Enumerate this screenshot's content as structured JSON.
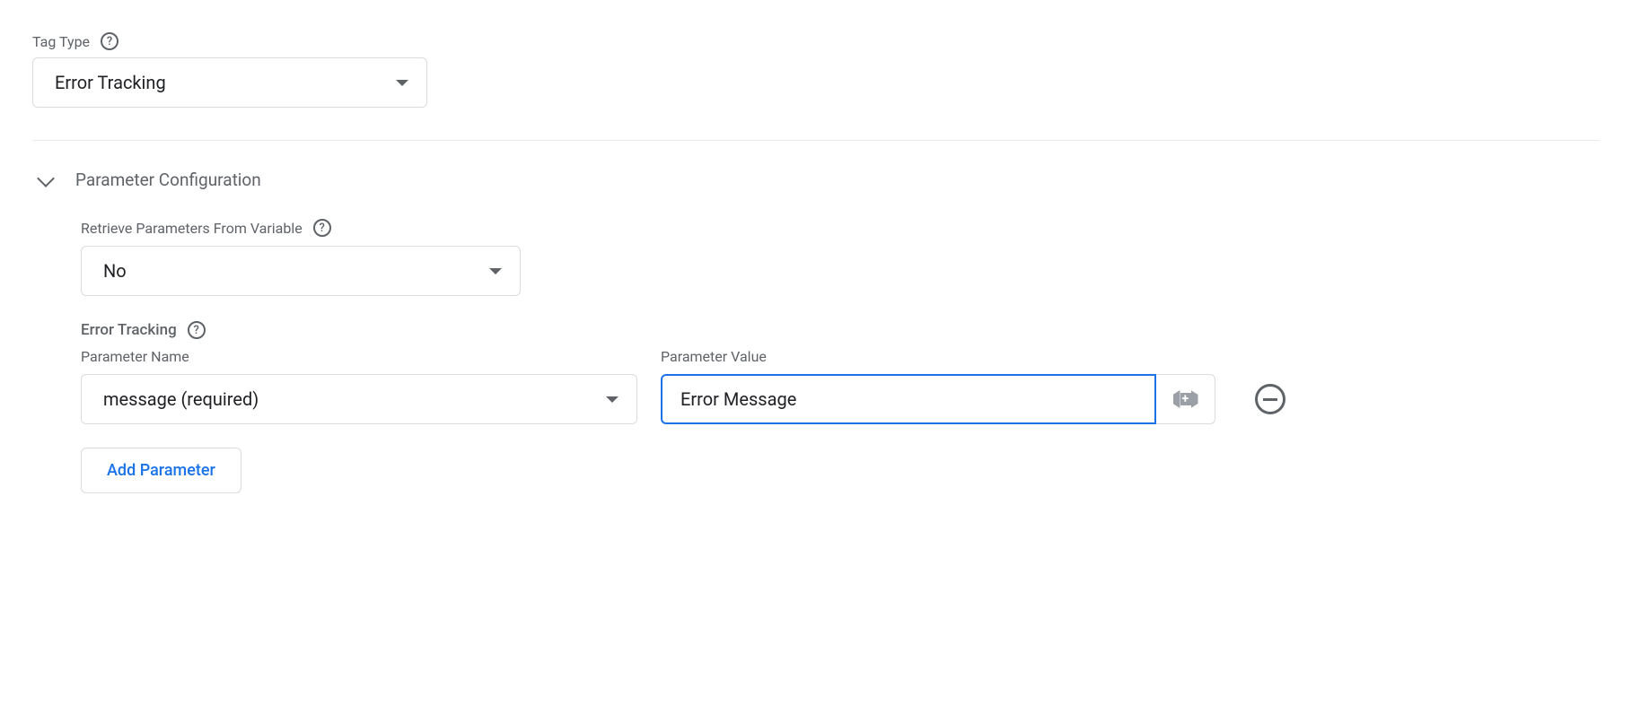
{
  "tagType": {
    "label": "Tag Type",
    "value": "Error Tracking"
  },
  "paramConfig": {
    "title": "Parameter Configuration",
    "retrieve": {
      "label": "Retrieve Parameters From Variable",
      "value": "No"
    },
    "errorTracking": {
      "label": "Error Tracking",
      "paramNameLabel": "Parameter Name",
      "paramValueLabel": "Parameter Value",
      "paramNameValue": "message (required)",
      "paramValueValue": "Error Message"
    },
    "addParameterLabel": "Add Parameter"
  }
}
